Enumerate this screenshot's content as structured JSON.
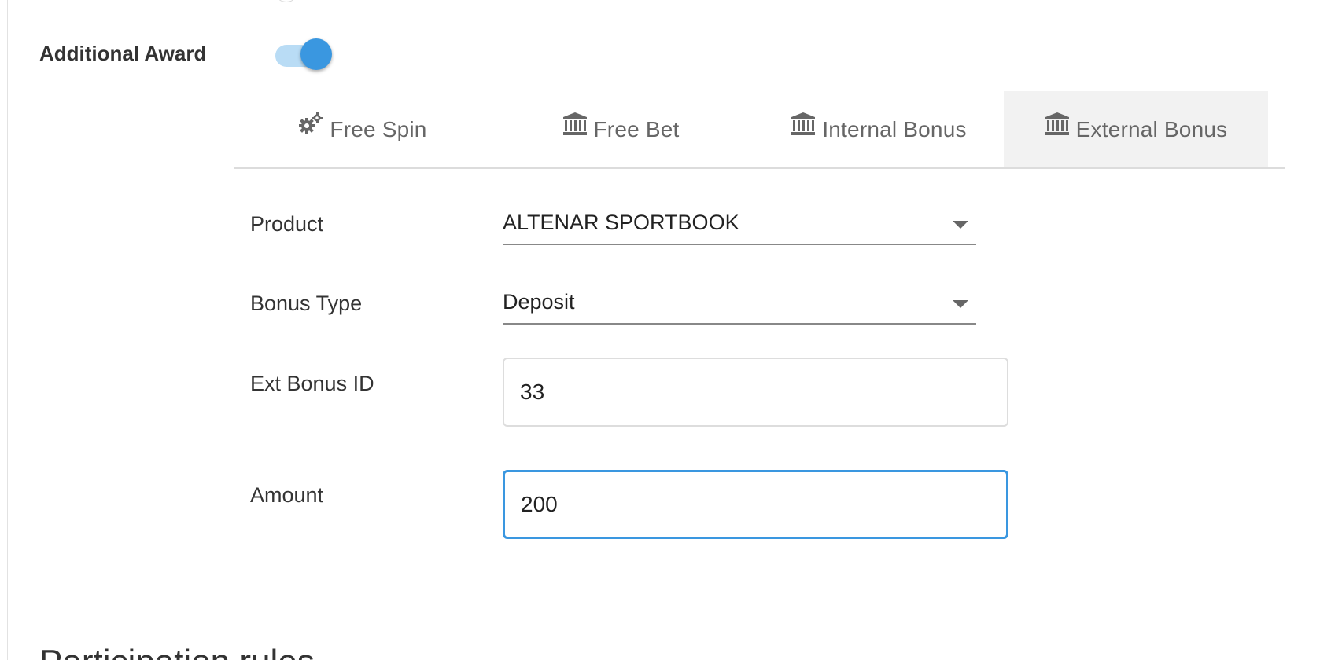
{
  "additional_award": {
    "label": "Additional Award",
    "enabled": true,
    "accent_color": "#3a97e0"
  },
  "tabs": [
    {
      "label": "Free Spin",
      "icon": "gears-icon",
      "active": false
    },
    {
      "label": "Free Bet",
      "icon": "bank-icon",
      "active": false
    },
    {
      "label": "Internal Bonus",
      "icon": "bank-icon",
      "active": false
    },
    {
      "label": "External Bonus",
      "icon": "bank-icon",
      "active": true
    }
  ],
  "form": {
    "product": {
      "label": "Product",
      "value": "ALTENAR SPORTBOOK"
    },
    "bonus_type": {
      "label": "Bonus Type",
      "value": "Deposit"
    },
    "ext_bonus_id": {
      "label": "Ext Bonus ID",
      "value": "33"
    },
    "amount": {
      "label": "Amount",
      "value": "200"
    }
  },
  "section": {
    "title": "Participation rules"
  }
}
